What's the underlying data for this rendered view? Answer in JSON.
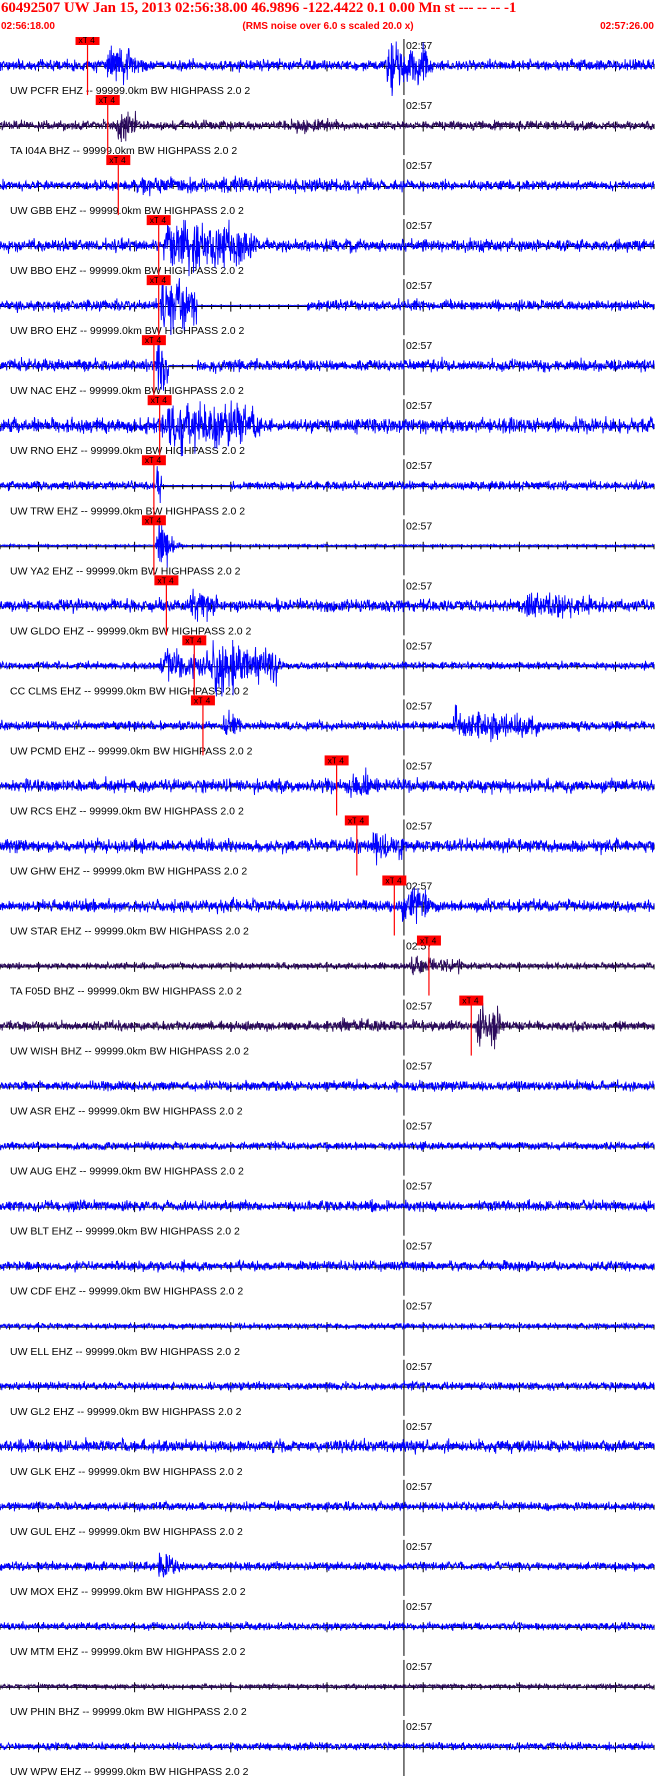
{
  "header": {
    "title": "60492507 UW Jan 15, 2013 02:56:38.00   46.9896 -122.4422  0.1 0.00 Mn st --- -- --  -1",
    "start_time": "02:56:18.00",
    "end_time": "02:57:26.00",
    "subtitle": "(RMS noise over 6.0 s scaled 20.0 x)"
  },
  "colors": {
    "trace_blue": "#0000ff",
    "trace_dark": "#2b0a5c",
    "pick_red": "#ff0000",
    "axis_black": "#000000",
    "header_red": "#ff0000"
  },
  "chart_data": {
    "type": "line",
    "title": "60492507 UW Jan 15, 2013 02:56:38.00   46.9896 -122.4422  0.1 0.00 Mn st --- -- --  -1",
    "subtitle": "(RMS noise over 6.0 s scaled 20.0 x)",
    "x_start": "02:56:18.00",
    "x_end": "02:57:26.00",
    "xlim_seconds": [
      0,
      68
    ],
    "minute_marker_label": "02:57",
    "minute_marker_seconds": 42,
    "pick_label": "xT 4",
    "grid": false,
    "series": [
      {
        "label": "UW PCFR EHZ -- 99999.0km BW  HIGHPASS  2.0  2",
        "color": "#0000ff",
        "pick_s": 9.1,
        "bursts": [
          {
            "t": 11,
            "d": 3,
            "a": 0.8
          },
          {
            "t": 40,
            "d": 4,
            "a": 0.95
          }
        ],
        "noise": 0.18
      },
      {
        "label": "TA I04A BHZ -- 99999.0km BW  HIGHPASS  2.0  2",
        "color": "#2b0a5c",
        "pick_s": 11.2,
        "bursts": [
          {
            "t": 12,
            "d": 2,
            "a": 0.6
          },
          {
            "t": 30,
            "d": 4,
            "a": 0.3
          }
        ],
        "noise": 0.15
      },
      {
        "label": "UW GBB EHZ -- 99999.0km BW  HIGHPASS  2.0  2",
        "color": "#0000ff",
        "pick_s": 12.3,
        "bursts": [
          {
            "t": 14,
            "d": 25,
            "a": 0.3
          }
        ],
        "noise": 0.16
      },
      {
        "label": "UW BBO EHZ -- 99999.0km BW  HIGHPASS  2.0  2",
        "color": "#0000ff",
        "pick_s": 16.5,
        "bursts": [
          {
            "t": 16.8,
            "d": 9,
            "a": 1.0
          }
        ],
        "noise": 0.2
      },
      {
        "label": "UW BRO EHZ -- 99999.0km BW  HIGHPASS  2.0  2",
        "color": "#0000ff",
        "pick_s": 16.5,
        "bursts": [
          {
            "t": 16.6,
            "d": 4,
            "a": 1.0
          }
        ],
        "noise": 0.18,
        "flat_from": 20.5,
        "flat_to": 32
      },
      {
        "label": "UW NAC EHZ -- 99999.0km BW  HIGHPASS  2.0  2",
        "color": "#0000ff",
        "pick_s": 16.0,
        "bursts": [
          {
            "t": 16.1,
            "d": 1.5,
            "a": 0.9
          }
        ],
        "noise": 0.2,
        "flat_from": 17.5,
        "flat_to": 20.5
      },
      {
        "label": "UW RNO EHZ -- 99999.0km BW  HIGHPASS  2.0  2",
        "color": "#0000ff",
        "pick_s": 16.6,
        "bursts": [
          {
            "t": 16.7,
            "d": 9.5,
            "a": 1.0
          }
        ],
        "noise": 0.25
      },
      {
        "label": "UW TRW EHZ -- 99999.0km BW  HIGHPASS  2.0  2",
        "color": "#0000ff",
        "pick_s": 16.0,
        "bursts": [
          {
            "t": 16.1,
            "d": 0.6,
            "a": 0.7
          }
        ],
        "noise": 0.15,
        "flat_from": 16.8,
        "flat_to": 24
      },
      {
        "label": "UW YA2 EHZ -- 99999.0km BW  HIGHPASS  2.0  2",
        "color": "#0000ff",
        "pick_s": 16.0,
        "bursts": [
          {
            "t": 16.1,
            "d": 1.2,
            "a": 1.0
          }
        ],
        "noise": 0.03
      },
      {
        "label": "UW GLDO EHZ -- 99999.0km BW  HIGHPASS  2.0  2",
        "color": "#0000ff",
        "pick_s": 17.3,
        "bursts": [
          {
            "t": 19.5,
            "d": 2.5,
            "a": 0.6
          },
          {
            "t": 54,
            "d": 7,
            "a": 0.55
          }
        ],
        "noise": 0.2
      },
      {
        "label": "CC CLMS EHZ -- 99999.0km BW  HIGHPASS  2.0  2",
        "color": "#0000ff",
        "pick_s": 20.2,
        "bursts": [
          {
            "t": 16.5,
            "d": 5,
            "a": 0.55
          },
          {
            "t": 21.8,
            "d": 6.5,
            "a": 1.0
          }
        ],
        "noise": 0.12
      },
      {
        "label": "UW PCMD EHZ -- 99999.0km BW  HIGHPASS  2.0  2",
        "color": "#0000ff",
        "pick_s": 21.1,
        "bursts": [
          {
            "t": 23,
            "d": 1.5,
            "a": 0.5
          },
          {
            "t": 47,
            "d": 9,
            "a": 0.55
          }
        ],
        "noise": 0.15
      },
      {
        "label": "UW RCS EHZ -- 99999.0km BW  HIGHPASS  2.0  2",
        "color": "#0000ff",
        "pick_s": 35.0,
        "bursts": [
          {
            "t": 36,
            "d": 2,
            "a": 0.6
          }
        ],
        "noise": 0.22
      },
      {
        "label": "UW GHW EHZ -- 99999.0km BW  HIGHPASS  2.0  2",
        "color": "#0000ff",
        "pick_s": 37.1,
        "bursts": [
          {
            "t": 38.5,
            "d": 3,
            "a": 0.55
          }
        ],
        "noise": 0.22
      },
      {
        "label": "UW STAR EHZ -- 99999.0km BW  HIGHPASS  2.0  2",
        "color": "#0000ff",
        "pick_s": 41.0,
        "bursts": [
          {
            "t": 41.5,
            "d": 2.5,
            "a": 0.8
          }
        ],
        "noise": 0.2
      },
      {
        "label": "TA F05D BHZ -- 99999.0km BW  HIGHPASS  2.0  2",
        "color": "#2b0a5c",
        "pick_s": 44.6,
        "bursts": [
          {
            "t": 42.5,
            "d": 5,
            "a": 0.35
          }
        ],
        "noise": 0.1
      },
      {
        "label": "UW WISH BHZ -- 99999.0km BW  HIGHPASS  2.0  2",
        "color": "#2b0a5c",
        "pick_s": 49.0,
        "bursts": [
          {
            "t": 49.4,
            "d": 2,
            "a": 1.0
          },
          {
            "t": 35,
            "d": 10,
            "a": 0.25
          }
        ],
        "noise": 0.15
      },
      {
        "label": "UW ASR EHZ -- 99999.0km BW  HIGHPASS  2.0  2",
        "color": "#0000ff",
        "pick_s": null,
        "bursts": [],
        "noise": 0.16
      },
      {
        "label": "UW AUG EHZ -- 99999.0km BW  HIGHPASS  2.0  2",
        "color": "#0000ff",
        "pick_s": null,
        "bursts": [],
        "noise": 0.13
      },
      {
        "label": "UW BLT EHZ -- 99999.0km BW  HIGHPASS  2.0  2",
        "color": "#0000ff",
        "pick_s": null,
        "bursts": [],
        "noise": 0.17
      },
      {
        "label": "UW CDF EHZ -- 99999.0km BW  HIGHPASS  2.0  2",
        "color": "#0000ff",
        "pick_s": null,
        "bursts": [],
        "noise": 0.16
      },
      {
        "label": "UW ELL EHZ -- 99999.0km BW  HIGHPASS  2.0  2",
        "color": "#0000ff",
        "pick_s": null,
        "bursts": [],
        "noise": 0.09
      },
      {
        "label": "UW GL2 EHZ -- 99999.0km BW  HIGHPASS  2.0  2",
        "color": "#0000ff",
        "pick_s": null,
        "bursts": [],
        "noise": 0.13
      },
      {
        "label": "UW GLK EHZ -- 99999.0km BW  HIGHPASS  2.0  2",
        "color": "#0000ff",
        "pick_s": null,
        "bursts": [],
        "noise": 0.2
      },
      {
        "label": "UW GUL EHZ -- 99999.0km BW  HIGHPASS  2.0  2",
        "color": "#0000ff",
        "pick_s": null,
        "bursts": [],
        "noise": 0.14
      },
      {
        "label": "UW MOX EHZ -- 99999.0km BW  HIGHPASS  2.0  2",
        "color": "#0000ff",
        "pick_s": null,
        "bursts": [
          {
            "t": 16.3,
            "d": 1.2,
            "a": 0.7
          }
        ],
        "noise": 0.14
      },
      {
        "label": "UW MTM EHZ -- 99999.0km BW  HIGHPASS  2.0  2",
        "color": "#0000ff",
        "pick_s": null,
        "bursts": [],
        "noise": 0.12
      },
      {
        "label": "UW PHIN BHZ -- 99999.0km BW  HIGHPASS  2.0  2",
        "color": "#2b0a5c",
        "pick_s": null,
        "bursts": [],
        "noise": 0.07
      },
      {
        "label": "UW WPW EHZ -- 99999.0km BW  HIGHPASS  2.0  2",
        "color": "#0000ff",
        "pick_s": null,
        "bursts": [],
        "noise": 0.12
      }
    ]
  }
}
